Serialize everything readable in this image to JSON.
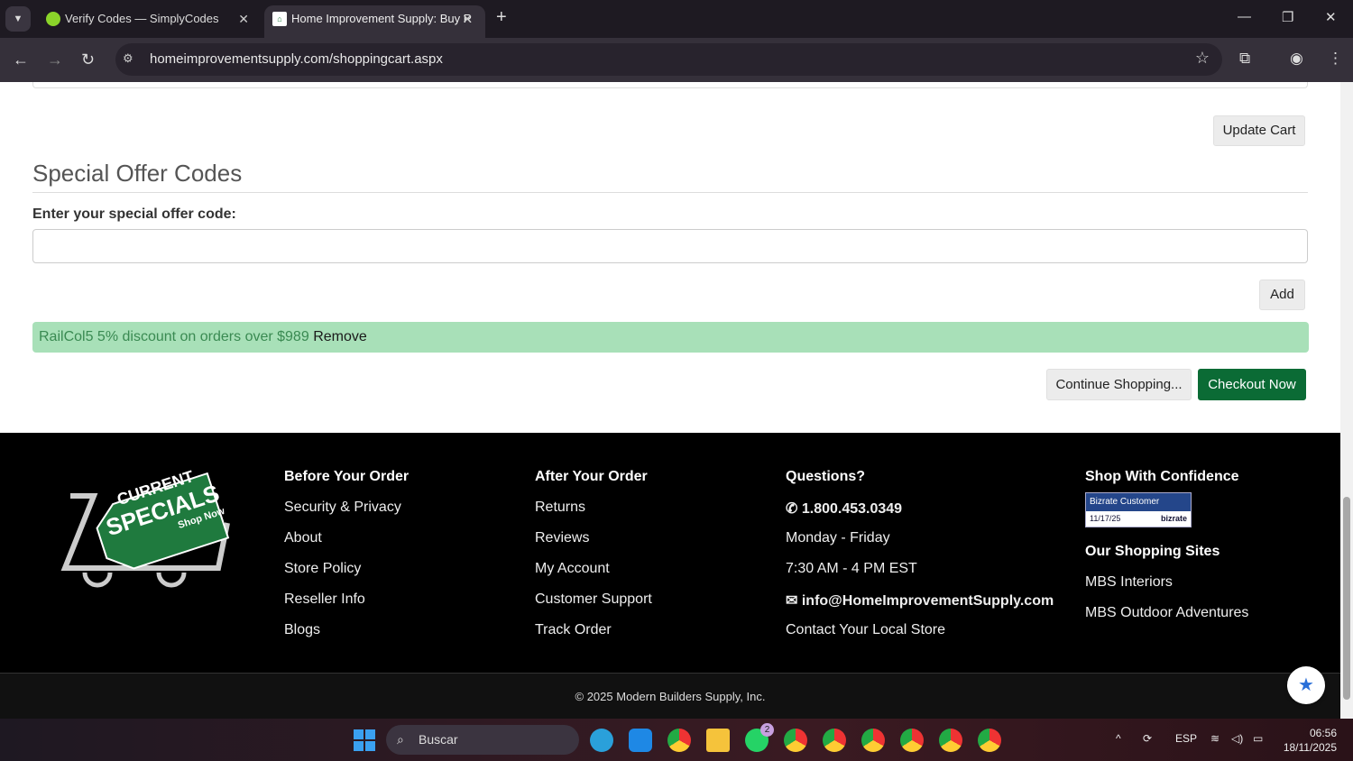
{
  "browser": {
    "tabs": [
      {
        "title": "Verify Codes — SimplyCodes",
        "active": false
      },
      {
        "title": "Home Improvement Supply: Buy R",
        "active": true
      }
    ],
    "url": "homeimprovementsupply.com/shoppingcart.aspx"
  },
  "cart": {
    "update_label": "Update Cart",
    "section_title": "Special Offer Codes",
    "code_label": "Enter your special offer code:",
    "code_value": "",
    "add_label": "Add",
    "applied_code": "RailCol5 5% discount on orders over $989",
    "remove_label": "Remove",
    "continue_label": "Continue Shopping...",
    "checkout_label": "Checkout Now"
  },
  "footer": {
    "logo": {
      "line1": "CURRENT",
      "line2": "SPECIALS",
      "line3": "Shop Now"
    },
    "before": {
      "title": "Before Your Order",
      "links": [
        "Security & Privacy",
        "About",
        "Store Policy",
        "Reseller Info",
        "Blogs"
      ]
    },
    "after": {
      "title": "After Your Order",
      "links": [
        "Returns",
        "Reviews",
        "My Account",
        "Customer Support",
        "Track Order"
      ]
    },
    "questions": {
      "title": "Questions?",
      "phone": "1.800.453.0349",
      "days": "Monday - Friday",
      "hours": "7:30 AM - 4 PM EST",
      "email": "info@HomeImprovementSupply.com",
      "contact": "Contact Your Local Store"
    },
    "confidence": {
      "title": "Shop With Confidence",
      "badge_title": "Bizrate Customer Certified",
      "badge_date": "11/17/25",
      "badge_brand": "bizrate",
      "sites_title": "Our Shopping Sites",
      "sites": [
        "MBS Interiors",
        "MBS Outdoor Adventures"
      ]
    },
    "copyright": "© 2025 Modern Builders Supply, Inc."
  },
  "taskbar": {
    "search": "Buscar",
    "whatsapp_badge": "2",
    "lang": "ESP",
    "time": "06:56",
    "date": "18/11/2025"
  },
  "colors": {
    "checkout": "#0b6b35",
    "alert_bg": "#a8e0b8"
  }
}
